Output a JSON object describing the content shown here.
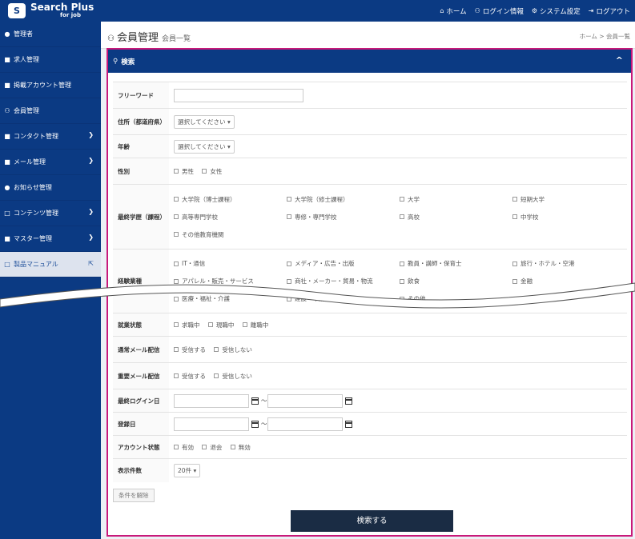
{
  "header": {
    "logo_mark": "S",
    "logo_title": "Search Plus",
    "logo_sub": "for job",
    "nav": [
      {
        "icon": "home-icon",
        "glyph": "⌂",
        "label": "ホーム"
      },
      {
        "icon": "login-info-icon",
        "glyph": "⚇",
        "label": "ログイン情報"
      },
      {
        "icon": "gear-icon",
        "glyph": "⚙",
        "label": "システム設定"
      },
      {
        "icon": "logout-icon",
        "glyph": "⇥",
        "label": "ログアウト"
      }
    ]
  },
  "sidebar": {
    "items": [
      {
        "glyph": "●",
        "label": "管理者",
        "chevron": ""
      },
      {
        "glyph": "■",
        "label": "求人管理",
        "chevron": ""
      },
      {
        "glyph": "■",
        "label": "掲載アカウント管理",
        "chevron": ""
      },
      {
        "glyph": "⚇",
        "label": "会員管理",
        "chevron": ""
      },
      {
        "glyph": "■",
        "label": "コンタクト管理",
        "chevron": "❯"
      },
      {
        "glyph": "■",
        "label": "メール管理",
        "chevron": "❯"
      },
      {
        "glyph": "●",
        "label": "お知らせ管理",
        "chevron": ""
      },
      {
        "glyph": "□",
        "label": "コンテンツ管理",
        "chevron": "❯"
      },
      {
        "glyph": "■",
        "label": "マスター管理",
        "chevron": "❯"
      }
    ],
    "manual": {
      "glyph": "□",
      "label": "製品マニュアル",
      "ext": "⇱"
    }
  },
  "content": {
    "title": "会員管理",
    "subtitle": "会員一覧",
    "breadcrumb_home": "ホーム",
    "breadcrumb_sep": ">",
    "breadcrumb_current": "会員一覧"
  },
  "panel": {
    "title": "検索",
    "caret": "^"
  },
  "form": {
    "freeword_label": "フリーワード",
    "address_label": "住所（都道府県）",
    "address_select": "選択してください",
    "age_label": "年齢",
    "age_select": "選択してください",
    "gender_label": "性別",
    "gender_options": [
      "男性",
      "女性"
    ],
    "education_label": "最終学歴（課程）",
    "education_options": [
      "大学院（博士課程）",
      "大学院（修士課程）",
      "大学",
      "短期大学",
      "高等専門学校",
      "専修・専門学校",
      "高校",
      "中学校",
      "その他教育機関"
    ],
    "experience_label": "経験業種",
    "experience_options": [
      "IT・通信",
      "メディア・広告・出版",
      "教員・講師・保育士",
      "旅行・ホテル・空港",
      "アパレル・販売・サービス",
      "商社・メーカー・貿易・物流",
      "飲食",
      "金融",
      "医療・福祉・介護",
      "建設・不動産",
      "その他"
    ],
    "employment_label": "就業状態",
    "employment_options": [
      "求職中",
      "現職中",
      "離職中"
    ],
    "normal_mail_label": "通常メール配信",
    "normal_mail_options": [
      "受信する",
      "受信しない"
    ],
    "important_mail_label": "重要メール配信",
    "important_mail_options": [
      "受信する",
      "受信しない"
    ],
    "last_login_label": "最終ログイン日",
    "register_label": "登録日",
    "range_sep": "～",
    "account_status_label": "アカウント状態",
    "account_status_options": [
      "有効",
      "退会",
      "無効"
    ],
    "per_page_label": "表示件数",
    "per_page_select": "20件",
    "clear_button": "条件を解除",
    "search_button": "検索する"
  }
}
